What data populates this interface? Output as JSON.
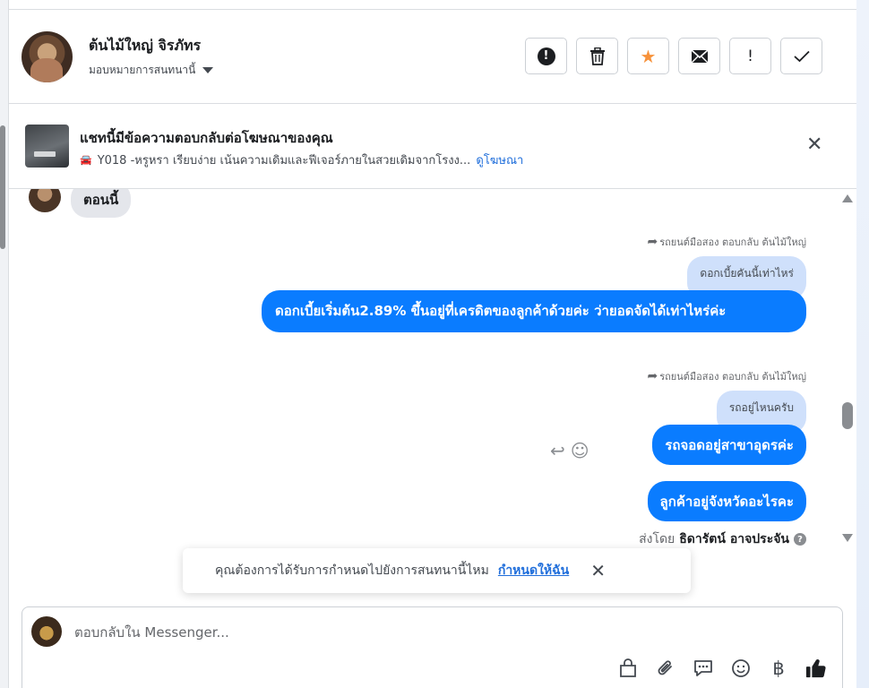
{
  "header": {
    "contact_name": "ต้นไม้ใหญ่ จิรภัทร",
    "assign_label": "มอบหมายการสนทนานี้",
    "actions": [
      {
        "name": "report-button",
        "icon": "report-icon"
      },
      {
        "name": "delete-button",
        "icon": "trash-icon"
      },
      {
        "name": "star-button",
        "icon": "star-icon",
        "color": "#f7923b"
      },
      {
        "name": "mark-unread-button",
        "icon": "mail-icon"
      },
      {
        "name": "follow-up-button",
        "icon": "exclamation-icon"
      },
      {
        "name": "done-button",
        "icon": "check-icon"
      }
    ]
  },
  "ad_banner": {
    "title": "แชทนี้มีข้อความตอบกลับต่อโฆษณาของคุณ",
    "ad_text": "Y018 -หรูหรา เรียบง่าย เน้นความเดิมและฟีเจอร์ภายในสวยเดิมจากโรงง...",
    "ad_link": "ดูโฆษณา"
  },
  "messages": {
    "incoming": "ตอนนี้",
    "reply1_meta": "รถยนต์มือสอง ตอบกลับ ต้นไม้ใหญ่",
    "reply1_quote": "ดอกเบี้ยคันนี้เท่าไหร่",
    "reply1_text": "ดอกเบี้ยเริ่มต้น2.89% ขึ้นอยู่ที่เครดิตของลูกค้าด้วยค่ะ ว่ายอดจัดได้เท่าไหร่ค่ะ",
    "reply2_meta": "รถยนต์มือสอง ตอบกลับ ต้นไม้ใหญ่",
    "reply2_quote": "รถอยู่ไหนครับ",
    "reply2_text": "รถจอดอยู่สาขาอุดรค่ะ",
    "message3_text": "ลูกค้าอยู่จังหวัดอะไรคะ",
    "sent_by_label": "ส่งโดย",
    "sent_by_name": "ธิดารัตน์ อาจประจัน"
  },
  "toast": {
    "text": "คุณต้องการได้รับการกำหนดไปยังการสนทนานี้ไหม",
    "link": "กำหนดให้ฉัน"
  },
  "composer": {
    "placeholder": "ตอบกลับใน Messenger...",
    "tools": [
      "bag-icon",
      "paperclip-icon",
      "saved-reply-icon",
      "emoji-icon",
      "baht-icon",
      "thumbs-up-icon"
    ],
    "baht_symbol": "฿"
  },
  "colors": {
    "outgoing_bubble": "#0a7cff",
    "quoted_bubble": "#cfe0fb",
    "incoming_bubble": "#e4e6eb",
    "link": "#216fdb"
  }
}
